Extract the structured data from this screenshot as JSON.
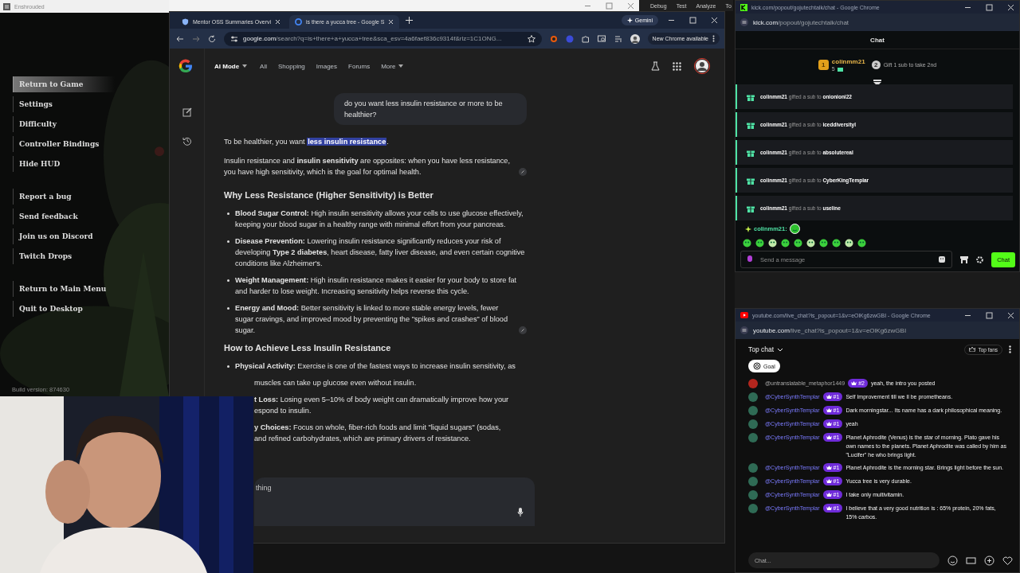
{
  "game": {
    "title": "Enshrouded",
    "menu_groups": [
      {
        "items": [
          {
            "label": "Return to Game",
            "selected": true
          },
          {
            "label": "Settings",
            "selected": false
          },
          {
            "label": "Difficulty",
            "selected": false
          },
          {
            "label": "Controller Bindings",
            "selected": false
          },
          {
            "label": "Hide HUD",
            "selected": false
          }
        ]
      },
      {
        "items": [
          {
            "label": "Report a bug",
            "selected": false
          },
          {
            "label": "Send feedback",
            "selected": false
          },
          {
            "label": "Join us on Discord",
            "selected": false
          },
          {
            "label": "Twitch Drops",
            "selected": false
          }
        ]
      },
      {
        "items": [
          {
            "label": "Return to Main Menu",
            "selected": false
          },
          {
            "label": "Quit to Desktop",
            "selected": false
          }
        ]
      }
    ],
    "build": "Build version:  874630"
  },
  "ide": {
    "menu": [
      "Debug",
      "Test",
      "Analyze",
      "To"
    ]
  },
  "browser": {
    "tabs": [
      {
        "title": "Mentor OSS Summaries Overvi",
        "selected": false
      },
      {
        "title": "is there a yucca tree - Google S",
        "selected": true
      }
    ],
    "gemini": "Gemini",
    "url_host": "google.com",
    "url_rest": "/search?q=is+there+a+yucca+tree&sca_esv=4a6faef836c9314f&rlz=1C1ONG...",
    "update": "New Chrome available",
    "nav": [
      {
        "label": "AI Mode",
        "selected": true
      },
      {
        "label": "All",
        "selected": false
      },
      {
        "label": "Shopping",
        "selected": false
      },
      {
        "label": "Images",
        "selected": false
      },
      {
        "label": "Forums",
        "selected": false
      },
      {
        "label": "More",
        "selected": false
      }
    ],
    "query": "do you want less insulin resistance or more to be healthier?",
    "answer": [
      {
        "kind": "highlight",
        "before": "To be healthier, you want ",
        "highlight": "less insulin resistance",
        "after": "."
      },
      {
        "kind": "paragraph",
        "text": "Insulin resistance and **insulin sensitivity** are opposites: when you have less resistance, you have high sensitivity, which is the goal for optimal health.",
        "link": true
      },
      {
        "kind": "heading",
        "text": "Why Less Resistance (Higher Sensitivity) is Better"
      },
      {
        "kind": "bullet",
        "text": "**Blood Sugar Control:** High insulin sensitivity allows your cells to use glucose effectively, keeping your blood sugar in a healthy range with minimal effort from your pancreas."
      },
      {
        "kind": "bullet",
        "text": "**Disease Prevention:** Lowering insulin resistance significantly reduces your risk of developing **Type 2 diabetes**, heart disease, fatty liver disease, and even certain cognitive conditions like Alzheimer's."
      },
      {
        "kind": "bullet",
        "text": "**Weight Management:** High insulin resistance makes it easier for your body to store fat and harder to lose weight. Increasing sensitivity helps reverse this cycle."
      },
      {
        "kind": "bullet",
        "text": "**Energy and Mood:** Better sensitivity is linked to more stable energy levels, fewer sugar cravings, and improved mood by preventing the \"spikes and crashes\" of blood sugar.",
        "link": true
      },
      {
        "kind": "heading",
        "text": "How to Achieve Less Insulin Resistance"
      },
      {
        "kind": "bullet",
        "text": "**Physical Activity:** Exercise is one of the fastest ways to increase insulin sensitivity, as"
      },
      {
        "kind": "fragment",
        "text": "muscles can take up glucose even without insulin."
      },
      {
        "kind": "fragment",
        "text": "**t Loss:** Losing even 5–10% of body weight can dramatically improve how your"
      },
      {
        "kind": "fragment",
        "text": "espond to insulin."
      },
      {
        "kind": "fragment",
        "text": "**y Choices:** Focus on whole, fiber-rich foods and limit \"liquid sugars\" (sodas,"
      },
      {
        "kind": "fragment",
        "text": "and refined carbohydrates, which are primary drivers of resistance."
      }
    ],
    "input_placeholder": "thing"
  },
  "kick": {
    "window_title": "kick.com/popout/gojutechtalk/chat - Google Chrome",
    "url_host": "kick.com",
    "url_rest": "/popout/gojutechtalk/chat",
    "header": "Chat",
    "leader": {
      "rank": "1",
      "name": "colinmm21",
      "count": "5",
      "next_rank": "2",
      "hint": "Gift 1 sub to take 2nd"
    },
    "gifts": [
      {
        "text": "**colinmm21** gifted a sub to **onionioni22**"
      },
      {
        "text": "**colinmm21** gifted a sub to **iceddiversityl**"
      },
      {
        "text": "**colinmm21** gifted a sub to **absolutereal**"
      },
      {
        "text": "**colinmm21** gifted a sub to **CyberKingTemplar**"
      },
      {
        "text": "**colinmm21** gifted a sub to **useline**"
      }
    ],
    "message_author": "colinmm21:",
    "placeholder": "Send a message",
    "send": "Chat"
  },
  "youtube": {
    "window_title": "youtube.com/live_chat?is_popout=1&v=eOlKg6zwGBI - Google Chrome",
    "url_host": "youtube.com",
    "url_rest": "/live_chat?is_popout=1&v=eOlKg6zwGBI",
    "mode": "Top chat",
    "top_fans": "Top fans",
    "goal": "Goal",
    "messages": [
      {
        "author": "@untranslatable_metaphor1449",
        "badge": "#2",
        "text": "yeah, the intro you posted",
        "color": "#b3261e"
      },
      {
        "author": "@CyberSynthTemplar",
        "badge": "#1",
        "text": "Self Improvement till we ll be prometheans.",
        "color": "#2f6b55"
      },
      {
        "author": "@CyberSynthTemplar",
        "badge": "#1",
        "text": "Dark morningstar... Its name has a dark philosophical meaning.",
        "color": "#2f6b55"
      },
      {
        "author": "@CyberSynthTemplar",
        "badge": "#1",
        "text": "yeah",
        "color": "#2f6b55"
      },
      {
        "author": "@CyberSynthTemplar",
        "badge": "#1",
        "text": "Planet Aphrodite (Venus) is the star of morning. Plato gave his own names to the planets. Planet Aphrodite was called by him as \"Lucifer\" he who brings light.",
        "color": "#2f6b55"
      },
      {
        "author": "@CyberSynthTemplar",
        "badge": "#1",
        "text": "Planet Aphrodite is the morning star. Brings light before the sun.",
        "color": "#2f6b55"
      },
      {
        "author": "@CyberSynthTemplar",
        "badge": "#1",
        "text": "Yucca tree is very durable.",
        "color": "#2f6b55"
      },
      {
        "author": "@CyberSynthTemplar",
        "badge": "#1",
        "text": "I take only multivitamin.",
        "color": "#2f6b55"
      },
      {
        "author": "@CyberSynthTemplar",
        "badge": "#1",
        "text": "I believe that a very good nutrition is : 65% protein, 20% fats, 15% carbos.",
        "color": "#2f6b55"
      }
    ],
    "placeholder": "Chat..."
  }
}
